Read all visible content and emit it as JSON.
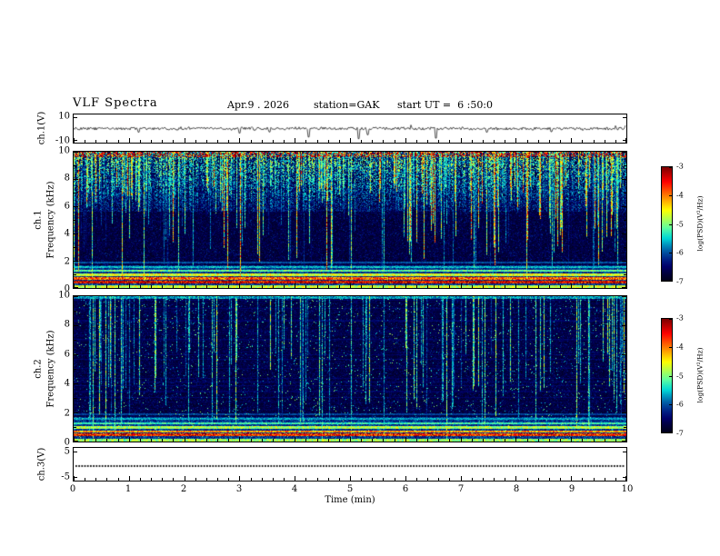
{
  "header": {
    "title": "VLF Spectra",
    "date": "Apr.9 . 2026",
    "station": "station=GAK",
    "start_ut": "start UT =  6 :50:0"
  },
  "axes": {
    "x_label": "Time (min)",
    "x_ticks": [
      "0",
      "1",
      "2",
      "3",
      "4",
      "5",
      "6",
      "7",
      "8",
      "9",
      "10"
    ]
  },
  "panels": {
    "wave1": {
      "label": "ch.1(V)",
      "y_ticks": [
        "10",
        "-10"
      ]
    },
    "spec1": {
      "channel": "ch.1",
      "axis_label": "Frequency (kHz)",
      "y_ticks": [
        "10",
        "8",
        "6",
        "4",
        "2",
        "0"
      ]
    },
    "spec2": {
      "channel": "ch.2",
      "axis_label": "Frequency (kHz)",
      "y_ticks": [
        "10",
        "8",
        "6",
        "4",
        "2",
        "0"
      ]
    },
    "wave3": {
      "label": "ch.3(V)",
      "y_ticks": [
        "5",
        "-5"
      ]
    }
  },
  "colorbar": {
    "label": "log(PSD)(V²/Hz)",
    "ticks": [
      "-3",
      "-4",
      "-5",
      "-6",
      "-7"
    ]
  },
  "chart_data": [
    {
      "type": "line",
      "panel": "ch.1(V) waveform",
      "xlabel": "Time (min)",
      "xlim": [
        0,
        10
      ],
      "ylim": [
        -10,
        10
      ],
      "y_ticks": [
        10,
        -10
      ],
      "description": "Continuous noisy voltage trace fluctuating within about ±2 V of 0 V for the full 10 minutes, with brief impulsive negative spikes reaching −6 to −9 V near t ≈ 4.2, 5.2, 5.3 and 6.5 min."
    },
    {
      "type": "heatmap",
      "panel": "ch.1 spectrogram",
      "xlabel": "Time (min)",
      "ylabel": "Frequency (kHz)",
      "xlim": [
        0,
        10
      ],
      "ylim": [
        0,
        10
      ],
      "zlabel": "log(PSD)(V²/Hz)",
      "zlim": [
        -7,
        -3
      ],
      "colormap": "jet (black/dark-blue low, green/yellow mid, red high)",
      "features": [
        "dense impulsive vertical broadband streaks (atmospherics) throughout, strongest above ~5 kHz where power reaches −4 to −3",
        "red/orange flecks along the very top edge near 10 kHz",
        "mostly quiet (−7, black) background between ~2 and 5 kHz with scattered blue speckle",
        "bright quasi-continuous horizontal hum bands below ~1.5 kHz at roughly −4 to −3"
      ]
    },
    {
      "type": "heatmap",
      "panel": "ch.2 spectrogram",
      "xlabel": "Time (min)",
      "ylabel": "Frequency (kHz)",
      "xlim": [
        0,
        10
      ],
      "ylim": [
        0,
        10
      ],
      "zlabel": "log(PSD)(V²/Hz)",
      "zlim": [
        -7,
        -3
      ],
      "colormap": "jet",
      "features": [
        "fainter, sparser vertical streaks (mostly blue/cyan, occasional green/yellow) than ch.1",
        "weak horizontal striping across all frequencies",
        "bright horizontal bands below ~1.5 kHz similar to ch.1"
      ]
    },
    {
      "type": "line",
      "panel": "ch.3(V) waveform",
      "xlim": [
        0,
        10
      ],
      "ylim": [
        -5,
        5
      ],
      "y_ticks": [
        5,
        -5
      ],
      "description": "Flat dotted trace holding at ≈0 V for the entire 10-minute interval."
    }
  ]
}
